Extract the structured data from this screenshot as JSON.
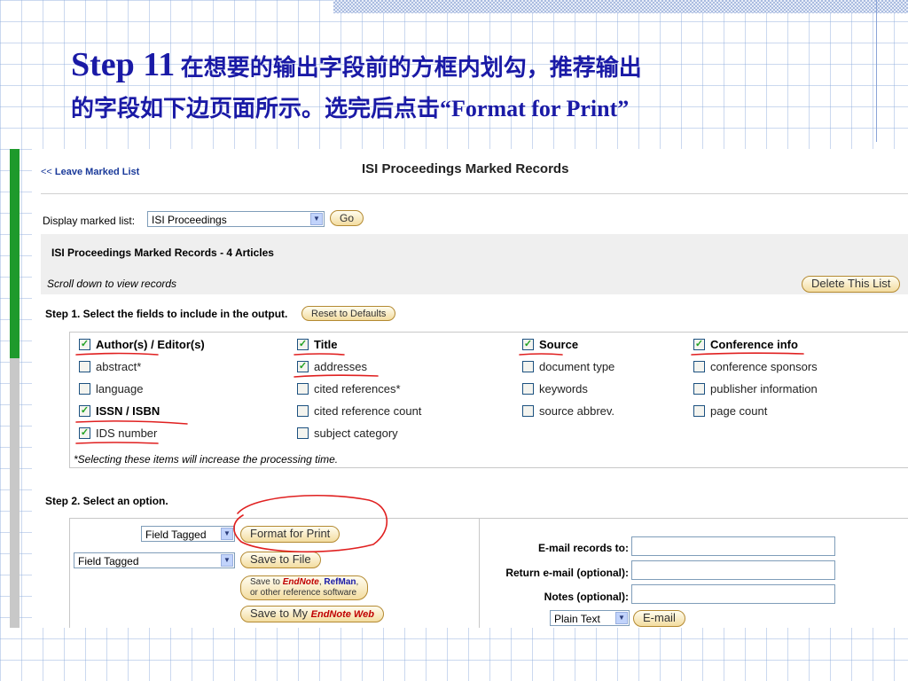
{
  "slide": {
    "title_step": "Step 11",
    "title_line1": " 在想要的输出字段前的方框内划勾，推荐输出",
    "title_line2_cn": "的字段如下边页面所示。选完后点击",
    "title_line2_quote": "“Format for Print”"
  },
  "page": {
    "leave_prefix": "<<",
    "leave_link": "Leave Marked List",
    "title": "ISI Proceedings Marked Records",
    "display_label": "Display marked list:",
    "display_value": "ISI Proceedings",
    "go_label": "Go",
    "record_count": "ISI Proceedings Marked Records - 4 Articles",
    "scroll_text": "Scroll down to view records",
    "delete_label": "Delete This List",
    "step1": "Step 1. Select the fields to include in the output.",
    "reset_label": "Reset to Defaults",
    "fields": [
      {
        "label": "Author(s) / Editor(s)",
        "checked": true,
        "bold": true
      },
      {
        "label": "Title",
        "checked": true,
        "bold": true
      },
      {
        "label": "Source",
        "checked": true,
        "bold": true
      },
      {
        "label": "Conference info",
        "checked": true,
        "bold": true
      },
      {
        "label": "abstract*",
        "checked": false
      },
      {
        "label": "addresses",
        "checked": true
      },
      {
        "label": "document type",
        "checked": false
      },
      {
        "label": "conference sponsors",
        "checked": false
      },
      {
        "label": "language",
        "checked": false
      },
      {
        "label": "cited references*",
        "checked": false
      },
      {
        "label": "keywords",
        "checked": false
      },
      {
        "label": "publisher information",
        "checked": false
      },
      {
        "label": "ISSN / ISBN",
        "checked": true,
        "bold": true
      },
      {
        "label": "cited reference count",
        "checked": false
      },
      {
        "label": "source abbrev.",
        "checked": false
      },
      {
        "label": "page count",
        "checked": false
      },
      {
        "label": "IDS number",
        "checked": true
      },
      {
        "label": "subject category",
        "checked": false
      }
    ],
    "note": "*Selecting these items will increase the processing time.",
    "step2": "Step 2. Select an option.",
    "format_select_1": "Field Tagged",
    "format_select_2": "Field Tagged",
    "format_print": "Format for Print",
    "save_file": "Save to File",
    "save_to": "Save to",
    "endnote": "EndNote",
    "refman": "RefMan",
    "other_ref": "or other reference software",
    "save_my": "Save to My",
    "endnote_web": "EndNote Web",
    "email_to_label": "E-mail records to:",
    "return_label": "Return e-mail (optional):",
    "notes_label": "Notes (optional):",
    "email_format": "Plain Text",
    "email_btn": "E-mail"
  },
  "colors": {
    "title_blue": "#1a1aa6",
    "link_blue": "#1a3a9a",
    "annotation_red": "#e02020",
    "button_gold": "#f3dca0",
    "check_green": "#21a121"
  }
}
